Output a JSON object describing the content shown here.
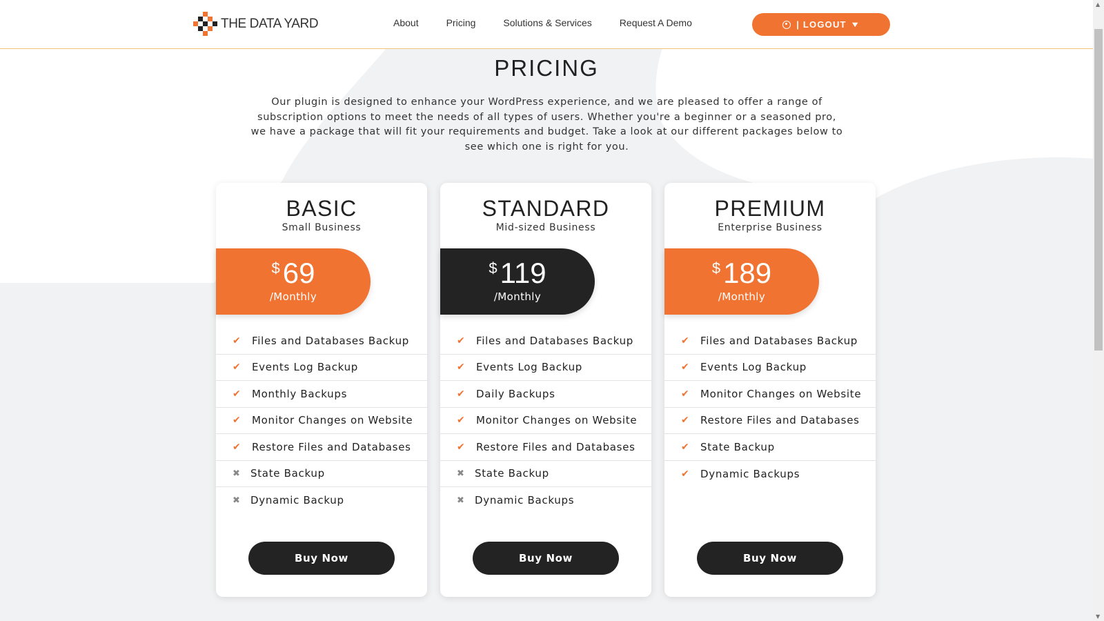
{
  "brand": {
    "name": "THE DATA YARD",
    "orange": "#f07331",
    "dark": "#232323"
  },
  "nav": {
    "items": [
      {
        "label": "About"
      },
      {
        "label": "Pricing"
      },
      {
        "label": "Solutions & Services"
      },
      {
        "label": "Request A Demo"
      }
    ],
    "logout_label": "| LOGOUT",
    "logout_icon": "user-circle-icon",
    "dropdown_icon": "chevron-down-icon"
  },
  "intro": {
    "title": "PRICING",
    "text": "Our plugin is designed to enhance your WordPress experience, and we are pleased to offer a range of subscription options to meet the needs of all types of users. Whether you're a beginner or a seasoned pro, we have a package that will fit your requirements and budget. Take a look at our different packages below to see which one is right for you."
  },
  "plans": [
    {
      "name": "BASIC",
      "subtitle": "Small Business",
      "currency": "$",
      "price": "69",
      "period": "/Monthly",
      "tag_color": "#f07331",
      "features": [
        {
          "label": "Files and Databases Backup",
          "included": true
        },
        {
          "label": "Events Log Backup",
          "included": true
        },
        {
          "label": "Monthly Backups",
          "included": true
        },
        {
          "label": "Monitor Changes on Website",
          "included": true
        },
        {
          "label": "Restore Files and Databases",
          "included": true
        },
        {
          "label": "State Backup",
          "included": false
        },
        {
          "label": "Dynamic Backup",
          "included": false
        }
      ],
      "button": "Buy Now"
    },
    {
      "name": "STANDARD",
      "subtitle": "Mid-sized Business",
      "currency": "$",
      "price": "119",
      "period": "/Monthly",
      "tag_color": "#232323",
      "features": [
        {
          "label": "Files and Databases Backup",
          "included": true
        },
        {
          "label": "Events Log Backup",
          "included": true
        },
        {
          "label": "Daily Backups",
          "included": true
        },
        {
          "label": "Monitor Changes on Website",
          "included": true
        },
        {
          "label": "Restore Files and Databases",
          "included": true
        },
        {
          "label": "State Backup",
          "included": false
        },
        {
          "label": "Dynamic Backups",
          "included": false
        }
      ],
      "button": "Buy Now"
    },
    {
      "name": "PREMIUM",
      "subtitle": "Enterprise Business",
      "currency": "$",
      "price": "189",
      "period": "/Monthly",
      "tag_color": "#f07331",
      "features": [
        {
          "label": "Files and Databases Backup",
          "included": true
        },
        {
          "label": "Events Log Backup",
          "included": true
        },
        {
          "label": "Monitor Changes on Website",
          "included": true
        },
        {
          "label": "Restore Files and Databases",
          "included": true
        },
        {
          "label": "State Backup",
          "included": true
        },
        {
          "label": "Dynamic Backups",
          "included": true
        }
      ],
      "button": "Buy Now"
    }
  ]
}
